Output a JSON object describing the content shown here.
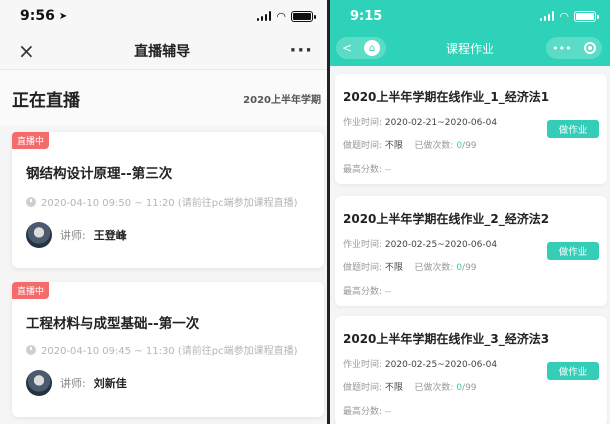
{
  "left": {
    "status_time": "9:56",
    "nav_title": "直播辅导",
    "close_icon": "×",
    "more_icon": "···",
    "section_title": "正在直播",
    "term": "2020上半年学期",
    "live_tag": "直播中",
    "teacher_label": "讲师:",
    "cards": [
      {
        "title": "钢结构设计原理--第三次",
        "time": "2020-04-10 09:50 ~ 11:20 (请前往pc端参加课程直播)",
        "teacher": "王登峰"
      },
      {
        "title": "工程材料与成型基础--第一次",
        "time": "2020-04-10 09:45 ~ 11:30 (请前往pc端参加课程直播)",
        "teacher": "刘新佳"
      }
    ]
  },
  "right": {
    "status_time": "9:15",
    "nav_title": "课程作业",
    "labels": {
      "homework_time": "作业时间:",
      "answer_time": "做题时间:",
      "done_count": "已做次数:",
      "max_score": "最高分数:",
      "button": "做作业"
    },
    "cards": [
      {
        "title": "2020上半年学期在线作业_1_经济法1",
        "period": "2020-02-21~2020-06-04",
        "answer_time": "不限",
        "count": "0",
        "total": "/99",
        "score": "--"
      },
      {
        "title": "2020上半年学期在线作业_2_经济法2",
        "period": "2020-02-25~2020-06-04",
        "answer_time": "不限",
        "count": "0",
        "total": "/99",
        "score": "--"
      },
      {
        "title": "2020上半年学期在线作业_3_经济法3",
        "period": "2020-02-25~2020-06-04",
        "answer_time": "不限",
        "count": "0",
        "total": "/99",
        "score": "--"
      }
    ]
  }
}
